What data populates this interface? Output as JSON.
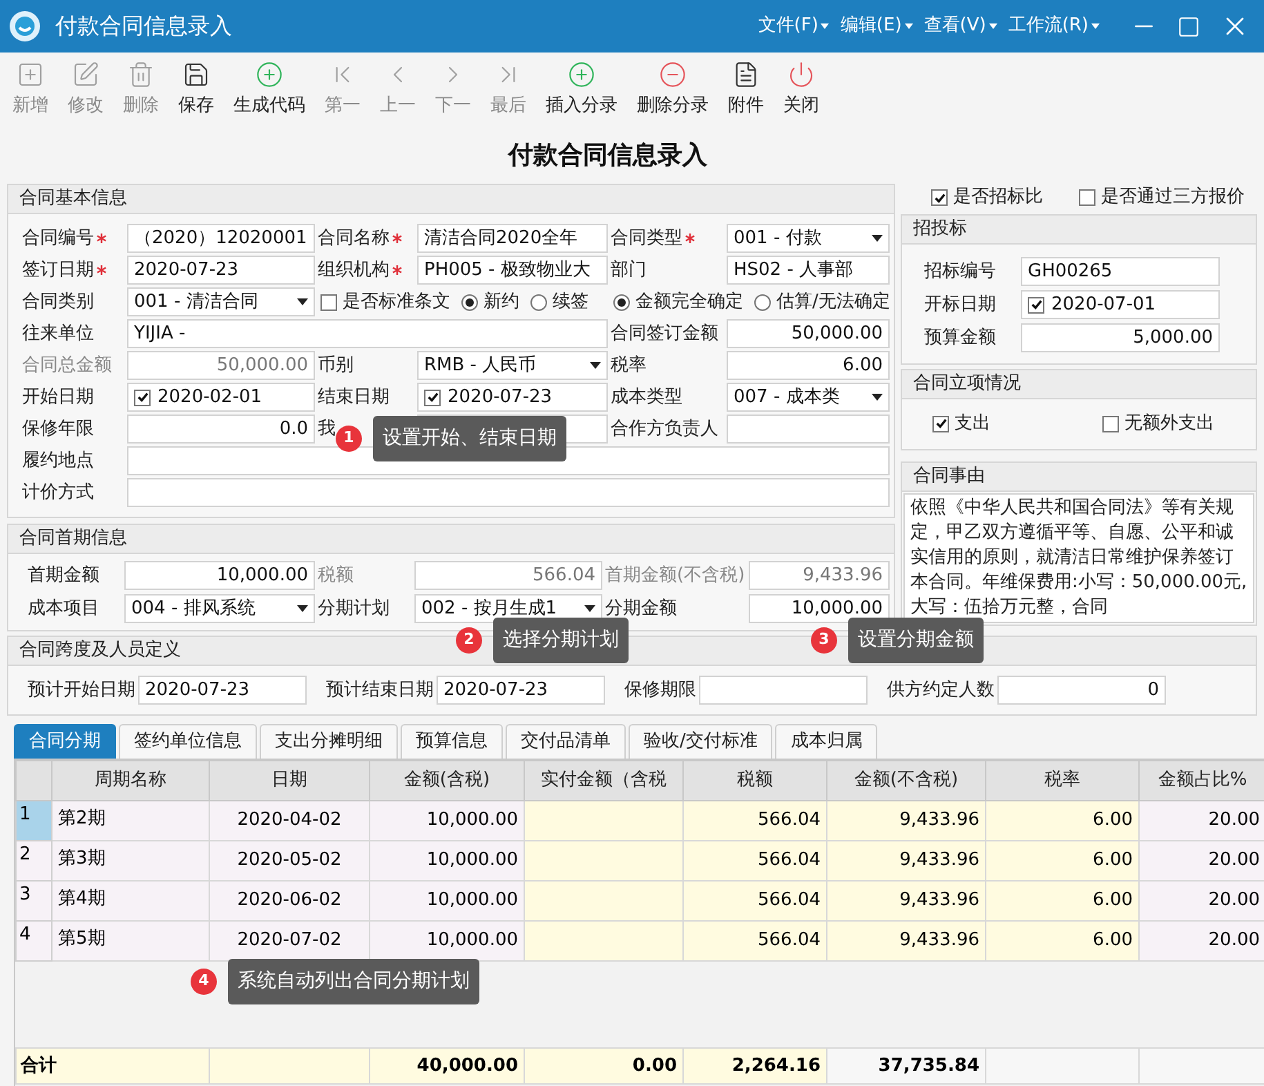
{
  "window": {
    "title": "付款合同信息录入"
  },
  "menus": [
    {
      "label": "文件(F)"
    },
    {
      "label": "编辑(E)"
    },
    {
      "label": "查看(V)"
    },
    {
      "label": "工作流(R)"
    }
  ],
  "toolbar": [
    {
      "label": "新增",
      "disabled": true
    },
    {
      "label": "修改",
      "disabled": true
    },
    {
      "label": "删除",
      "disabled": true
    },
    {
      "label": "保存",
      "disabled": false
    },
    {
      "label": "生成代码",
      "disabled": false
    },
    {
      "label": "第一",
      "disabled": true
    },
    {
      "label": "上一",
      "disabled": true
    },
    {
      "label": "下一",
      "disabled": true
    },
    {
      "label": "最后",
      "disabled": true
    },
    {
      "label": "插入分录",
      "disabled": false
    },
    {
      "label": "删除分录",
      "disabled": false
    },
    {
      "label": "附件",
      "disabled": false
    },
    {
      "label": "关闭",
      "disabled": false
    }
  ],
  "page_title": "付款合同信息录入",
  "basic": {
    "title": "合同基本信息",
    "rows": [
      [
        {
          "kind": "text",
          "label": "合同编号",
          "required": true,
          "value": "（2020）12020001"
        },
        {
          "kind": "text",
          "label": "合同名称",
          "required": true,
          "value": "清洁合同2020全年"
        },
        {
          "kind": "select",
          "label": "合同类型",
          "required": true,
          "value": "001 - 付款"
        }
      ],
      [
        {
          "kind": "text",
          "label": "签订日期",
          "required": true,
          "value": "2020-07-23"
        },
        {
          "kind": "text",
          "label": "组织机构",
          "required": true,
          "value": "PH005 - 极致物业大"
        },
        {
          "kind": "text",
          "label": "部门",
          "value": "HS02 - 人事部"
        }
      ],
      [
        {
          "kind": "select",
          "label": "合同类别",
          "value": "001 - 清洁合同"
        },
        {
          "kind": "options",
          "items": [
            {
              "kind": "checkbox",
              "label": "是否标准条文",
              "checked": false
            },
            {
              "kind": "radio",
              "label": "新约",
              "selected": true
            },
            {
              "kind": "radio",
              "label": "续签",
              "selected": false
            }
          ]
        },
        {
          "kind": "options",
          "items": [
            {
              "kind": "radio",
              "label": "金额完全确定",
              "selected": true
            },
            {
              "kind": "radio",
              "label": "估算/无法确定",
              "selected": false
            }
          ]
        }
      ],
      [
        {
          "kind": "text",
          "label": "往来单位",
          "value": "YIJIA -"
        },
        "",
        {
          "kind": "number",
          "label": "合同签订金额",
          "value": "50,000.00"
        }
      ],
      [
        {
          "kind": "number",
          "label": "合同总金额",
          "disabled": true,
          "value": "50,000.00"
        },
        {
          "kind": "select",
          "label": "币别",
          "value": "RMB - 人民币"
        },
        {
          "kind": "number",
          "label": "税率",
          "value": "6.00"
        }
      ],
      [
        {
          "kind": "date",
          "label": "开始日期",
          "checked": true,
          "value": "2020-02-01"
        },
        {
          "kind": "date",
          "label": "结束日期",
          "checked": true,
          "value": "2020-07-23"
        },
        {
          "kind": "select",
          "label": "成本类型",
          "value": "007 - 成本类"
        }
      ],
      [
        {
          "kind": "number",
          "label": "保修年限",
          "value": "0.0"
        },
        {
          "kind": "text",
          "label": "我"
        },
        {
          "kind": "text",
          "label": "合作方负责人"
        }
      ],
      [
        {
          "kind": "text",
          "label": "履约地点"
        }
      ],
      [
        {
          "kind": "text",
          "label": "计价方式"
        }
      ]
    ]
  },
  "first_period": {
    "title": "合同首期信息",
    "rows": [
      [
        {
          "kind": "number",
          "label": "首期金额",
          "value": "10,000.00"
        },
        {
          "kind": "number",
          "label": "税额",
          "disabled": true,
          "value": "566.04"
        },
        {
          "kind": "number",
          "label": "首期金额(不含税)",
          "disabled": true,
          "value": "9,433.96"
        }
      ],
      [
        {
          "kind": "select",
          "label": "成本项目",
          "value": "004 - 排风系统"
        },
        {
          "kind": "select",
          "label": "分期计划",
          "value": "002 - 按月生成1"
        },
        {
          "kind": "number",
          "label": "分期金额",
          "value": "10,000.00"
        }
      ]
    ]
  },
  "span": {
    "title": "合同跨度及人员定义",
    "fields": [
      {
        "kind": "text",
        "label": "预计开始日期",
        "value": "2020-07-23"
      },
      {
        "kind": "text",
        "label": "预计结束日期",
        "value": "2020-07-23"
      },
      {
        "kind": "text",
        "label": "保修期限"
      },
      {
        "kind": "number",
        "label": "供方约定人数",
        "value": "0"
      }
    ]
  },
  "right": {
    "checks": [
      {
        "label": "是否招标比",
        "checked": true
      },
      {
        "label": "是否通过三方报价",
        "checked": false
      }
    ],
    "bidding": {
      "title": "招投标",
      "fields": [
        {
          "kind": "text",
          "label": "招标编号",
          "value": "GH00265"
        },
        {
          "kind": "date",
          "label": "开标日期",
          "checked": true,
          "value": "2020-07-01"
        },
        {
          "kind": "number",
          "label": "预算金额",
          "value": "5,000.00"
        }
      ]
    },
    "project": {
      "title": "合同立项情况",
      "checks": [
        {
          "label": "支出",
          "checked": true
        },
        {
          "label": "无额外支出",
          "checked": false
        }
      ]
    },
    "reason": {
      "title": "合同事由",
      "text": "依照《中华人民共和国合同法》等有关规定，甲乙双方遵循平等、自愿、公平和诚实信用的原则，就清洁日常维护保养签订本合同。年维保费用:小写：50,000.00元,大写：伍拾万元整，合同"
    }
  },
  "tabs": [
    {
      "label": "合同分期",
      "selected": true
    },
    {
      "label": "签约单位信息",
      "selected": false
    },
    {
      "label": "支出分摊明细",
      "selected": false
    },
    {
      "label": "预算信息",
      "selected": false
    },
    {
      "label": "交付品清单",
      "selected": false
    },
    {
      "label": "验收/交付标准",
      "selected": false
    },
    {
      "label": "成本归属",
      "selected": false
    }
  ],
  "table": {
    "columns": [
      {
        "label": "周期名称",
        "editable": false
      },
      {
        "label": "日期",
        "editable": false
      },
      {
        "label": "金额(含税)",
        "editable": false
      },
      {
        "label": "实付金额（含税",
        "editable": true
      },
      {
        "label": "税额",
        "editable": true
      },
      {
        "label": "金额(不含税)",
        "editable": true
      },
      {
        "label": "税率",
        "editable": true
      },
      {
        "label": "金额占比%",
        "editable": false
      }
    ],
    "rows": [
      {
        "number": "1",
        "selected": true,
        "cells": [
          "第2期",
          "2020-04-02",
          "10,000.00",
          null,
          "566.04",
          "9,433.96",
          "6.00",
          "20.00"
        ]
      },
      {
        "number": "2",
        "selected": false,
        "cells": [
          "第3期",
          "2020-05-02",
          "10,000.00",
          null,
          "566.04",
          "9,433.96",
          "6.00",
          "20.00"
        ]
      },
      {
        "number": "3",
        "selected": false,
        "cells": [
          "第4期",
          "2020-06-02",
          "10,000.00",
          null,
          "566.04",
          "9,433.96",
          "6.00",
          "20.00"
        ]
      },
      {
        "number": "4",
        "selected": false,
        "cells": [
          "第5期",
          "2020-07-02",
          "10,000.00",
          null,
          "566.04",
          "9,433.96",
          "6.00",
          "20.00"
        ]
      }
    ],
    "total": {
      "label": "合计",
      "cells": [
        null,
        "40,000.00",
        "0.00",
        "2,264.16",
        "37,735.84",
        null,
        null
      ]
    }
  },
  "tips": [
    {
      "number": "1",
      "text": "设置开始、结束日期"
    },
    {
      "number": "2",
      "text": "选择分期计划"
    },
    {
      "number": "3",
      "text": "设置分期金额"
    },
    {
      "number": "4",
      "text": "系统自动列出合同分期计划"
    }
  ]
}
